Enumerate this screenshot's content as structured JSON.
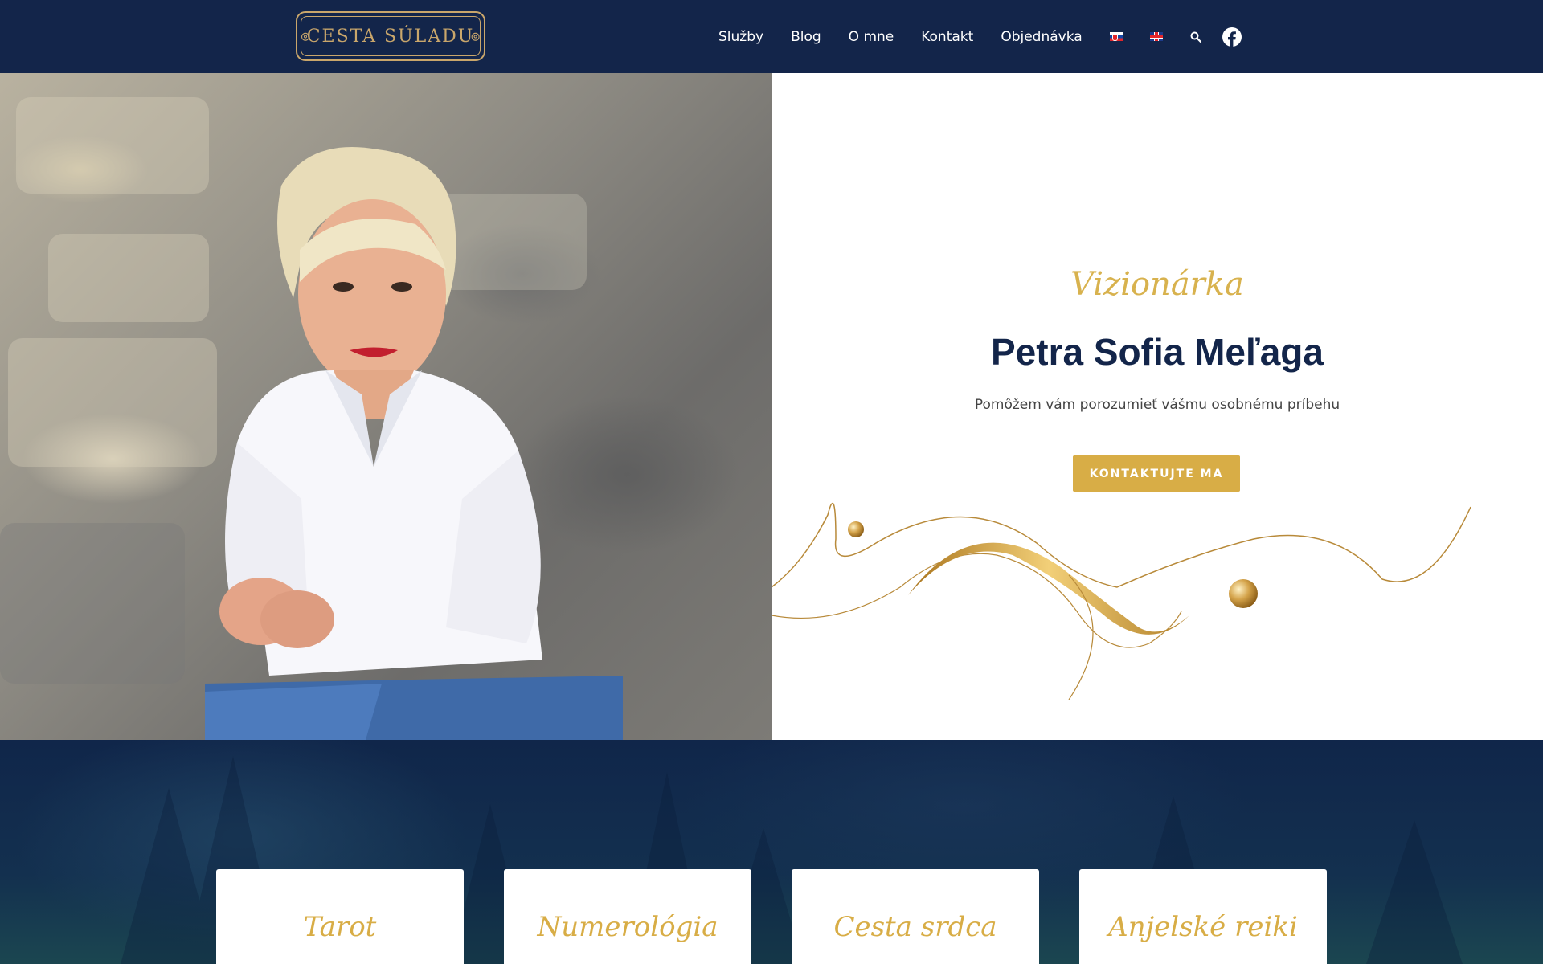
{
  "header": {
    "logo_text": "CESTA SÚLADU",
    "nav": [
      {
        "label": "Služby"
      },
      {
        "label": "Blog"
      },
      {
        "label": "O mne"
      },
      {
        "label": "Kontakt"
      },
      {
        "label": "Objednávka"
      }
    ],
    "icons": [
      "flag-sk-icon",
      "flag-gb-icon",
      "search-icon",
      "facebook-icon"
    ]
  },
  "hero": {
    "kicker": "Vizionárka",
    "title": "Petra Sofia Meľaga",
    "subtitle": "Pomôžem vám porozumieť vášmu osobnému príbehu",
    "cta_label": "KONTAKTUJTE MA"
  },
  "services": {
    "cards": [
      {
        "title": "Tarot"
      },
      {
        "title": "Numerológia"
      },
      {
        "title": "Cesta srdca"
      },
      {
        "title": "Anjelské reiki"
      }
    ]
  },
  "colors": {
    "navy": "#13254a",
    "gold": "#d8ad46",
    "white": "#ffffff"
  }
}
